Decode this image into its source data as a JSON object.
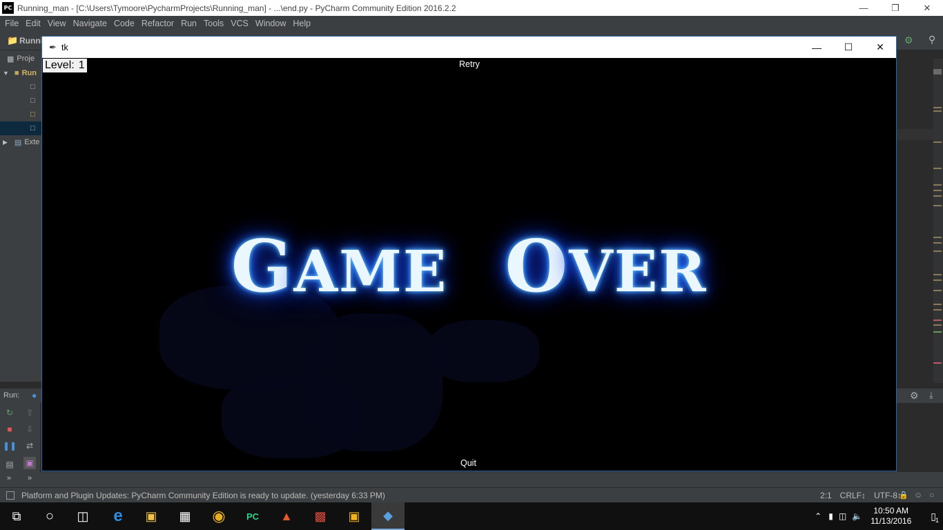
{
  "ide": {
    "window_title": "Running_man - [C:\\Users\\Tymoore\\PycharmProjects\\Running_man] - ...\\end.py - PyCharm Community Edition 2016.2.2",
    "logo_text": "PC",
    "menu": [
      "File",
      "Edit",
      "View",
      "Navigate",
      "Code",
      "Refactor",
      "Run",
      "Tools",
      "VCS",
      "Window",
      "Help"
    ],
    "project_header": "Runni",
    "project_tab": "Proje",
    "tree": {
      "root": "Run",
      "external": "Exte"
    },
    "run_label": "Run:",
    "status_message": "Platform and Plugin Updates: PyCharm Community Edition is ready to update. (yesterday 6:33 PM)",
    "status_right": {
      "position": "2:1",
      "line_sep": "CRLF↕",
      "encoding": "UTF-8↕"
    }
  },
  "tk": {
    "title": "tk",
    "level_label": "Level:",
    "level_value": "1",
    "retry_label": "Retry",
    "quit_label": "Quit",
    "gameover": {
      "word1_first": "G",
      "word1_rest": "AME",
      "word2_first": "O",
      "word2_rest": "VER"
    }
  },
  "taskbar": {
    "time": "10:50 AM",
    "date": "11/13/2016",
    "notification_count": "1"
  },
  "colors": {
    "glow": "#2a8cff",
    "tk_border": "#2b6aa5"
  }
}
